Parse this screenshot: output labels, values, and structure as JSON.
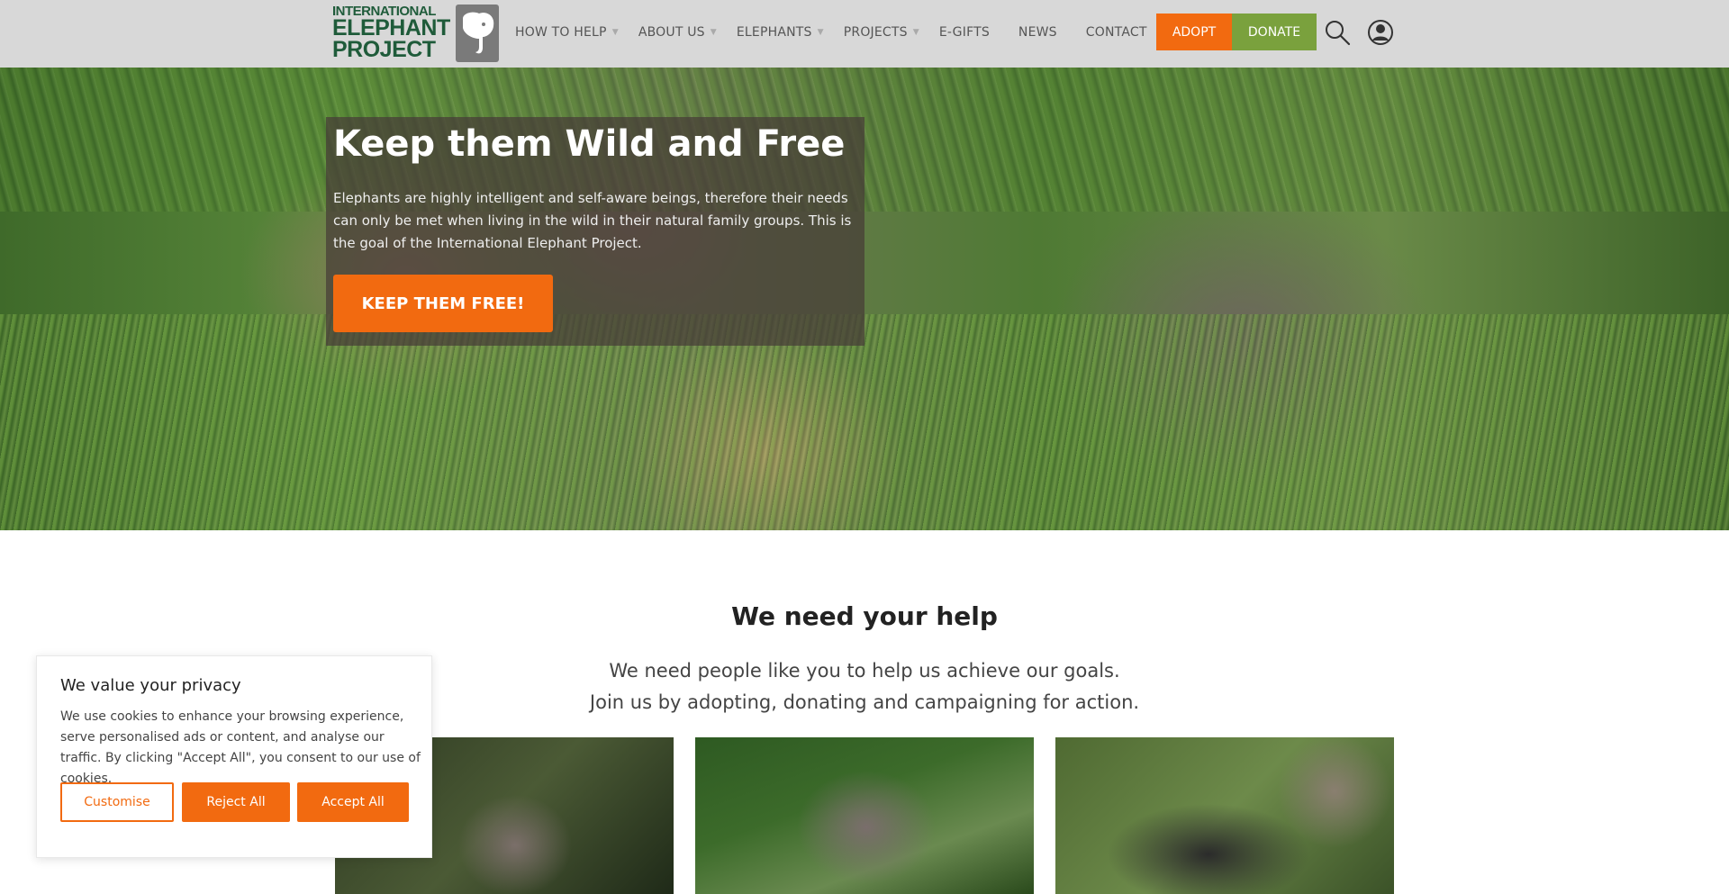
{
  "logo": {
    "line1": "INTERNATIONAL",
    "line2": "ELEPHANT",
    "line3": "PROJECT"
  },
  "nav": {
    "items": [
      {
        "label": "HOW TO HELP",
        "has_dropdown": true
      },
      {
        "label": "ABOUT US",
        "has_dropdown": true
      },
      {
        "label": "ELEPHANTS",
        "has_dropdown": true
      },
      {
        "label": "PROJECTS",
        "has_dropdown": true
      },
      {
        "label": "E-GIFTS",
        "has_dropdown": false
      },
      {
        "label": "NEWS",
        "has_dropdown": false
      },
      {
        "label": "CONTACT",
        "has_dropdown": false
      }
    ],
    "adopt_label": "ADOPT",
    "donate_label": "DONATE",
    "search_icon": "search-icon",
    "account_icon": "user-account-icon"
  },
  "hero": {
    "title": "Keep them Wild and Free",
    "text": "Elephants are highly intelligent and self-aware beings, therefore their needs can only be met when living in the wild in their natural family groups. This is the goal of the International Elephant Project.",
    "button_label": "KEEP THEM FREE!"
  },
  "help": {
    "title": "We need your help",
    "line1": "We need people like you to help us achieve our goals.",
    "line2": "Join us by adopting, donating and campaigning for action."
  },
  "cookie": {
    "title": "We value your privacy",
    "text": "We use cookies to enhance your browsing experience, serve personalised ads or content, and analyse our traffic. By clicking \"Accept All\", you consent to our use of cookies.",
    "customise_label": "Customise",
    "reject_label": "Reject All",
    "accept_label": "Accept All"
  },
  "colors": {
    "accent_orange": "#f26a10",
    "accent_green": "#7aa13d",
    "logo_green": "#1f5b3a",
    "header_bg": "#d8d8d8"
  }
}
